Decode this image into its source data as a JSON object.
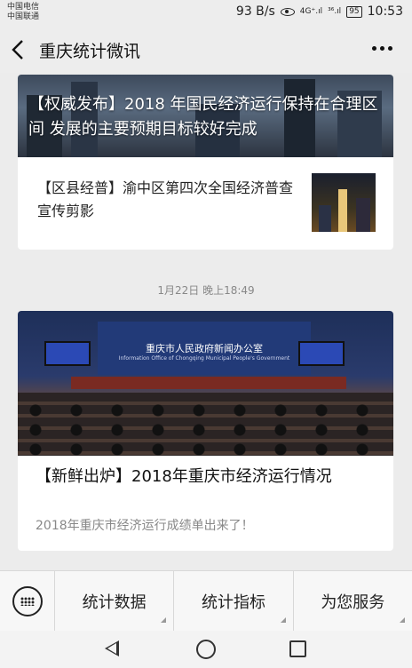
{
  "status_bar": {
    "carrier1": "中国电信",
    "carrier2": "中国联通",
    "speed": "93 B/s",
    "signal1": "4G⁺.ıl",
    "signal2": "³⁶.ıl",
    "battery": "95",
    "time": "10:53"
  },
  "header": {
    "title": "重庆统计微讯"
  },
  "feed": {
    "card1": {
      "cover_title": "【权威发布】2018 年国民经济运行保持在合理区间 发展的主要预期目标较好完成",
      "item_title": "【区县经普】渝中区第四次全国经济普查宣传剪影"
    },
    "timestamp": "1月22日 晚上18:49",
    "card2": {
      "stage_text": "重庆市人民政府新闻办公室",
      "stage_sub": "Information Office of Chongqing Municipal People's Government",
      "title": "【新鲜出炉】2018年重庆市经济运行情况",
      "description": "2018年重庆市经济运行成绩单出来了！"
    }
  },
  "bottom_menu": {
    "items": [
      "统计数据",
      "统计指标",
      "为您服务"
    ]
  }
}
